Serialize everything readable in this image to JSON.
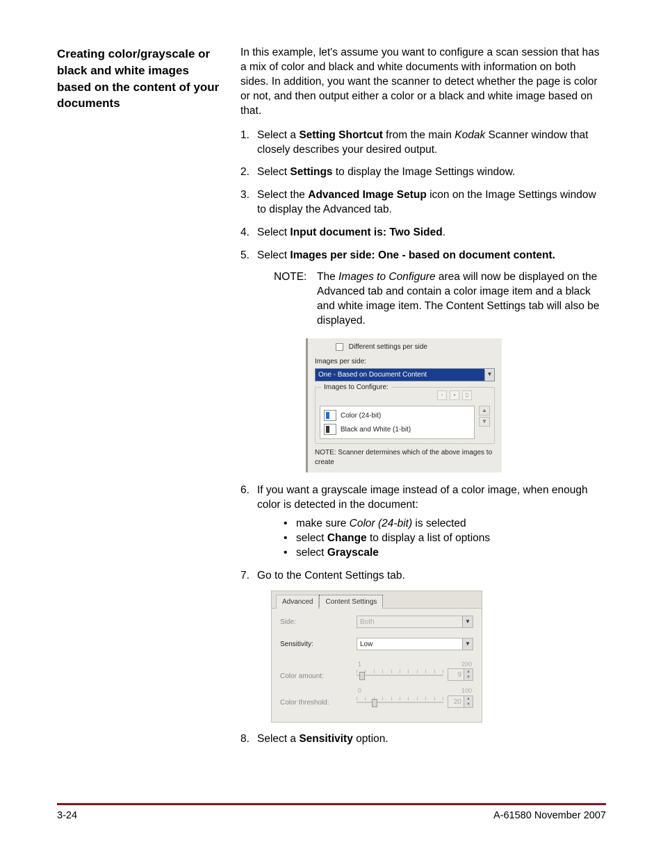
{
  "heading": "Creating color/grayscale or black and white images based on the content of your documents",
  "intro": {
    "p1": "In this example, let's assume you want to configure a scan session that has a mix of color and black and white documents with information on both sides. In addition, you want the scanner to detect whether the page is color or not, and then output either a color or a black and white image based on that."
  },
  "steps": {
    "s1_pre": "Select a ",
    "s1_b1": "Setting Shortcut",
    "s1_mid": " from the main ",
    "s1_i1": "Kodak",
    "s1_post": " Scanner window that closely describes your desired output.",
    "s2_pre": "Select ",
    "s2_b1": "Settings",
    "s2_post": " to display the Image Settings window.",
    "s3_pre": "Select the ",
    "s3_b1": "Advanced Image Setup",
    "s3_post": " icon on the Image Settings window to display the Advanced tab.",
    "s4_pre": "Select ",
    "s4_b1": "Input document is: Two Sided",
    "s4_post": ".",
    "s5_pre": "Select ",
    "s5_b1": "Images per side: One - based on document content.",
    "s5_note_label": "NOTE:",
    "s5_note_pre": "The ",
    "s5_note_i1": "Images to Configure",
    "s5_note_post": " area will now be displayed on the Advanced tab and contain a color image item and a black and white image item. The Content Settings tab will also be displayed.",
    "s6_text": "If you want a grayscale image instead of a color image, when enough color is detected in the document:",
    "s6_b1_pre": "make sure ",
    "s6_b1_i": "Color (24-bit)",
    "s6_b1_post": " is selected",
    "s6_b2_pre": "select ",
    "s6_b2_b": "Change",
    "s6_b2_post": " to display a list of options",
    "s6_b3_pre": "select ",
    "s6_b3_b": "Grayscale",
    "s7_text": "Go to the Content Settings tab.",
    "s8_pre": "Select a ",
    "s8_b1": "Sensitivity",
    "s8_post": " option."
  },
  "shot1": {
    "chk_label": "Different settings per side",
    "images_per_side_label": "Images per side:",
    "combo_value": "One - Based on Document Content",
    "group_title": "Images to Configure:",
    "item1": "Color (24-bit)",
    "item2": "Black and White (1-bit)",
    "note": "NOTE: Scanner determines which of the above images to create"
  },
  "shot2": {
    "tab1": "Advanced",
    "tab2": "Content Settings",
    "side_label": "Side:",
    "side_value": "Both",
    "sensitivity_label": "Sensitivity:",
    "sensitivity_value": "Low",
    "color_amount_label": "Color amount:",
    "color_amount_min": "1",
    "color_amount_max": "200",
    "color_amount_value": "9",
    "color_threshold_label": "Color threshold:",
    "color_threshold_min": "0",
    "color_threshold_max": "100",
    "color_threshold_value": "20"
  },
  "footer": {
    "left": "3-24",
    "right": "A-61580  November 2007"
  }
}
